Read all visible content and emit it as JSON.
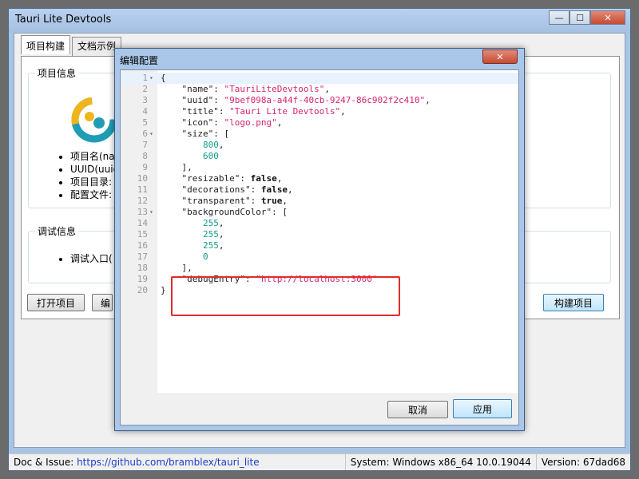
{
  "window": {
    "title": "Tauri Lite Devtools",
    "min_glyph": "—",
    "max_glyph": "☐",
    "close_glyph": "✕"
  },
  "tabs": [
    "项目构建",
    "文档示例"
  ],
  "project_info": {
    "group_title": "项目信息",
    "items": [
      "项目名(na",
      "UUID(uuid",
      "项目目录:",
      "配置文件:"
    ]
  },
  "debug_info": {
    "group_title": "调试信息",
    "items": [
      "调试入口("
    ]
  },
  "buttons": {
    "open_project": "打开项目",
    "partial": "编",
    "build_project": "构建项目"
  },
  "status": {
    "doc_label": "Doc & Issue: ",
    "doc_link": "https://github.com/bramblex/tauri_lite",
    "system": "System: Windows x86_64 10.0.19044",
    "version": "Version: 67dad68"
  },
  "dialog": {
    "title": "编辑配置",
    "close_glyph": "✕",
    "cancel": "取消",
    "apply": "应用",
    "code_lines": [
      [
        {
          "t": "{",
          "c": "p"
        }
      ],
      [
        {
          "t": "    \"name\": ",
          "c": "p"
        },
        {
          "t": "\"TauriLiteDevtools\"",
          "c": "s"
        },
        {
          "t": ",",
          "c": "p"
        }
      ],
      [
        {
          "t": "    \"uuid\": ",
          "c": "p"
        },
        {
          "t": "\"9bef098a-a44f-40cb-9247-86c902f2c410\"",
          "c": "s"
        },
        {
          "t": ",",
          "c": "p"
        }
      ],
      [
        {
          "t": "    \"title\": ",
          "c": "p"
        },
        {
          "t": "\"Tauri Lite Devtools\"",
          "c": "s"
        },
        {
          "t": ",",
          "c": "p"
        }
      ],
      [
        {
          "t": "    \"icon\": ",
          "c": "p"
        },
        {
          "t": "\"logo.png\"",
          "c": "s"
        },
        {
          "t": ",",
          "c": "p"
        }
      ],
      [
        {
          "t": "    \"size\": [",
          "c": "p"
        }
      ],
      [
        {
          "t": "        ",
          "c": "p"
        },
        {
          "t": "800",
          "c": "n"
        },
        {
          "t": ",",
          "c": "p"
        }
      ],
      [
        {
          "t": "        ",
          "c": "p"
        },
        {
          "t": "600",
          "c": "n"
        }
      ],
      [
        {
          "t": "    ],",
          "c": "p"
        }
      ],
      [
        {
          "t": "    \"resizable\": ",
          "c": "p"
        },
        {
          "t": "false",
          "c": "k"
        },
        {
          "t": ",",
          "c": "p"
        }
      ],
      [
        {
          "t": "    \"decorations\": ",
          "c": "p"
        },
        {
          "t": "false",
          "c": "k"
        },
        {
          "t": ",",
          "c": "p"
        }
      ],
      [
        {
          "t": "    \"transparent\": ",
          "c": "p"
        },
        {
          "t": "true",
          "c": "k"
        },
        {
          "t": ",",
          "c": "p"
        }
      ],
      [
        {
          "t": "    \"backgroundColor\": [",
          "c": "p"
        }
      ],
      [
        {
          "t": "        ",
          "c": "p"
        },
        {
          "t": "255",
          "c": "n"
        },
        {
          "t": ",",
          "c": "p"
        }
      ],
      [
        {
          "t": "        ",
          "c": "p"
        },
        {
          "t": "255",
          "c": "n"
        },
        {
          "t": ",",
          "c": "p"
        }
      ],
      [
        {
          "t": "        ",
          "c": "p"
        },
        {
          "t": "255",
          "c": "n"
        },
        {
          "t": ",",
          "c": "p"
        }
      ],
      [
        {
          "t": "        ",
          "c": "p"
        },
        {
          "t": "0",
          "c": "n"
        }
      ],
      [
        {
          "t": "    ],",
          "c": "p"
        }
      ],
      [
        {
          "t": "    \"debugEntry\": ",
          "c": "p"
        },
        {
          "t": "\"http://localhost:3000\"",
          "c": "s"
        }
      ],
      [
        {
          "t": "}",
          "c": "p"
        }
      ]
    ],
    "fold_lines": [
      1,
      6,
      13
    ],
    "fold_glyph": "▾"
  },
  "colors": {
    "string": "#d6246e",
    "number": "#0f9a8c",
    "highlight_box": "#e12b2b",
    "link": "#1a3fc6"
  }
}
